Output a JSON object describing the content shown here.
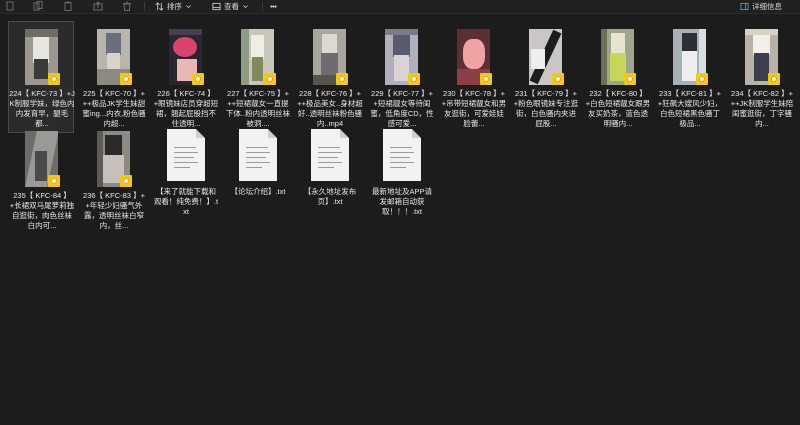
{
  "toolbar": {
    "sort_label": "排序",
    "view_label": "查看",
    "more_label": "•••",
    "details_label": "详细信息"
  },
  "files": [
    {
      "name": "224【 KFC-73 】+JK制服学妹，绿色内内发育早，腿毛都...",
      "type": "video",
      "selected": true
    },
    {
      "name": "225【 KFC-70 】+++极品JK学生妹甜蜜ing...内衣,粉色骚内超...",
      "type": "video"
    },
    {
      "name": "226【 KFC-74 】+眼镜妹店员穿超短裙，翘起屁股挡不住透明...",
      "type": "video"
    },
    {
      "name": "227【 KFC-75 】+++短裙靓女一直提下体..粉内透明丝袜被洞....",
      "type": "video"
    },
    {
      "name": "228【 KFC-76 】+++极品美女..身材超好..透明丝袜粉色骚内..mp4",
      "type": "video"
    },
    {
      "name": "229【 KFC-77 】++短裙靓女等待闺蜜，低角度CD，性感可爱...",
      "type": "video"
    },
    {
      "name": "230【 KFC-78 】++吊带短裙靓女和男友逛街，可爱娃娃脸蕾...",
      "type": "video"
    },
    {
      "name": "231【 KFC-79 】++粉色眼镜妹专注逛街，白色骚内夹进屁股...",
      "type": "video"
    },
    {
      "name": "232【 KFC-80 】+白色短裙靓女跟男友买奶茶，蓝色透明骚内...",
      "type": "video"
    },
    {
      "name": "233【 KFC-81 】++狂飙大嫂风少妇，白色短裙黑色骚丁极品...",
      "type": "video"
    },
    {
      "name": "234【 KFC-82 】+++JK制服学生妹陪闺蜜逛街，丁字骚内...",
      "type": "video"
    },
    {
      "name": "235【 KFC-84 】+长裙双马尾萝莉独自逛街，肉色丝袜白内可...",
      "type": "video"
    },
    {
      "name": "236【 KFC-83 】++年轻少妇骚气外露，透明丝袜白窄内，丝...",
      "type": "video"
    },
    {
      "name": "【来了就能下载和观看！纯免费！】.txt",
      "type": "text"
    },
    {
      "name": "【论坛介绍】.txt",
      "type": "text"
    },
    {
      "name": "【永久地址发布页】.txt",
      "type": "text"
    },
    {
      "name": "最新地址及APP请发邮箱自动获取！！！.txt",
      "type": "text"
    }
  ],
  "colors": {
    "background": "#1c1c1c",
    "selection": "#2b2b2b",
    "badge": "#f5c51b",
    "accent_icon": "#4aa3ff"
  }
}
